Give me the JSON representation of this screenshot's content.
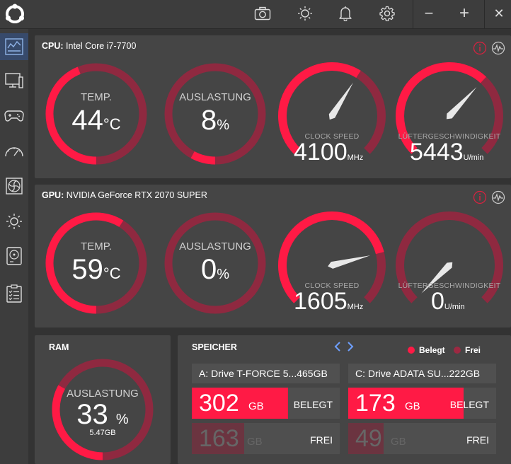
{
  "colors": {
    "accent": "#ff1a45",
    "accent_dim": "#9c2942",
    "track": "#8f2940",
    "panel": "#454545",
    "background": "#333333"
  },
  "toolbar": {
    "icons": [
      "camera-icon",
      "brightness-icon",
      "bell-icon",
      "gear-icon"
    ],
    "minimize": "−",
    "maximize": "+",
    "close": "✕"
  },
  "sidebar": {
    "items": [
      "dashboard-icon",
      "monitor-icon",
      "gamepad-icon",
      "speedometer-icon",
      "fan-icon",
      "light-icon",
      "disk-icon",
      "checklist-icon"
    ]
  },
  "cpu": {
    "label": "CPU:",
    "name": "Intel Core i7-7700",
    "temp": {
      "label": "TEMP.",
      "value": "44",
      "unit": "°C",
      "fraction": 0.44
    },
    "load": {
      "label": "AUSLASTUNG",
      "value": "8",
      "unit": "%",
      "fraction": 0.08
    },
    "clock": {
      "label": "CLOCK SPEED",
      "value": "4100",
      "unit": "MHz",
      "fraction": 0.62
    },
    "fan": {
      "label": "LÜFTERGESCHWINDIGKEIT",
      "value": "5443",
      "unit": "U/min",
      "fraction": 0.66
    }
  },
  "gpu": {
    "label": "GPU:",
    "name": "NVIDIA GeForce RTX 2070 SUPER",
    "temp": {
      "label": "TEMP.",
      "value": "59",
      "unit": "°C",
      "fraction": 0.59
    },
    "load": {
      "label": "AUSLASTUNG",
      "value": "0",
      "unit": "%",
      "fraction": 0.0
    },
    "clock": {
      "label": "CLOCK SPEED",
      "value": "1605",
      "unit": "MHz",
      "fraction": 0.78
    },
    "fan": {
      "label": "LÜFTERGESCHWINDIGKEIT",
      "value": "0",
      "unit": "U/min",
      "fraction": 0.0
    }
  },
  "ram": {
    "title": "RAM",
    "label": "AUSLASTUNG",
    "value": "33",
    "unit": "%",
    "sub": "5.47GB",
    "fraction": 0.33
  },
  "storage": {
    "title": "SPEICHER",
    "legend_used": "Belegt",
    "legend_free": "Frei",
    "drives": [
      {
        "name": "A: Drive T-FORCE 5...465GB",
        "used": "302",
        "free": "163",
        "gb": "GB",
        "used_tag": "BELEGT",
        "free_tag": "FREI",
        "used_fraction": 0.65
      },
      {
        "name": "C: Drive ADATA SU...222GB",
        "used": "173",
        "free": "49",
        "gb": "GB",
        "used_tag": "BELEGT",
        "free_tag": "FREI",
        "used_fraction": 0.78
      }
    ]
  }
}
